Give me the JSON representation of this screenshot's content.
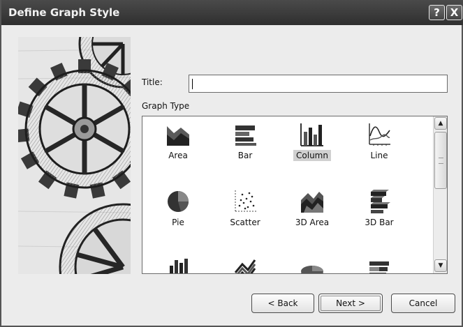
{
  "window": {
    "title": "Define Graph Style",
    "help_glyph": "?",
    "close_glyph": "X"
  },
  "form": {
    "title_label": "Title:",
    "title_value": "",
    "graph_type_label": "Graph Type"
  },
  "graph_types": [
    {
      "label": "Area",
      "icon": "area-chart-icon"
    },
    {
      "label": "Bar",
      "icon": "bar-chart-icon"
    },
    {
      "label": "Column",
      "icon": "column-chart-icon",
      "selected": true
    },
    {
      "label": "Line",
      "icon": "line-chart-icon"
    },
    {
      "label": "Pie",
      "icon": "pie-chart-icon"
    },
    {
      "label": "Scatter",
      "icon": "scatter-chart-icon"
    },
    {
      "label": "3D Area",
      "icon": "3d-area-chart-icon"
    },
    {
      "label": "3D Bar",
      "icon": "3d-bar-chart-icon"
    },
    {
      "label": "",
      "icon": "3d-column-chart-icon"
    },
    {
      "label": "",
      "icon": "3d-line-chart-icon"
    },
    {
      "label": "",
      "icon": "3d-pie-chart-icon"
    },
    {
      "label": "",
      "icon": "stacked-bar-chart-icon"
    }
  ],
  "scrollbar": {
    "up_glyph": "▲",
    "down_glyph": "▼"
  },
  "buttons": {
    "back": "< Back",
    "next": "Next >",
    "cancel": "Cancel"
  }
}
